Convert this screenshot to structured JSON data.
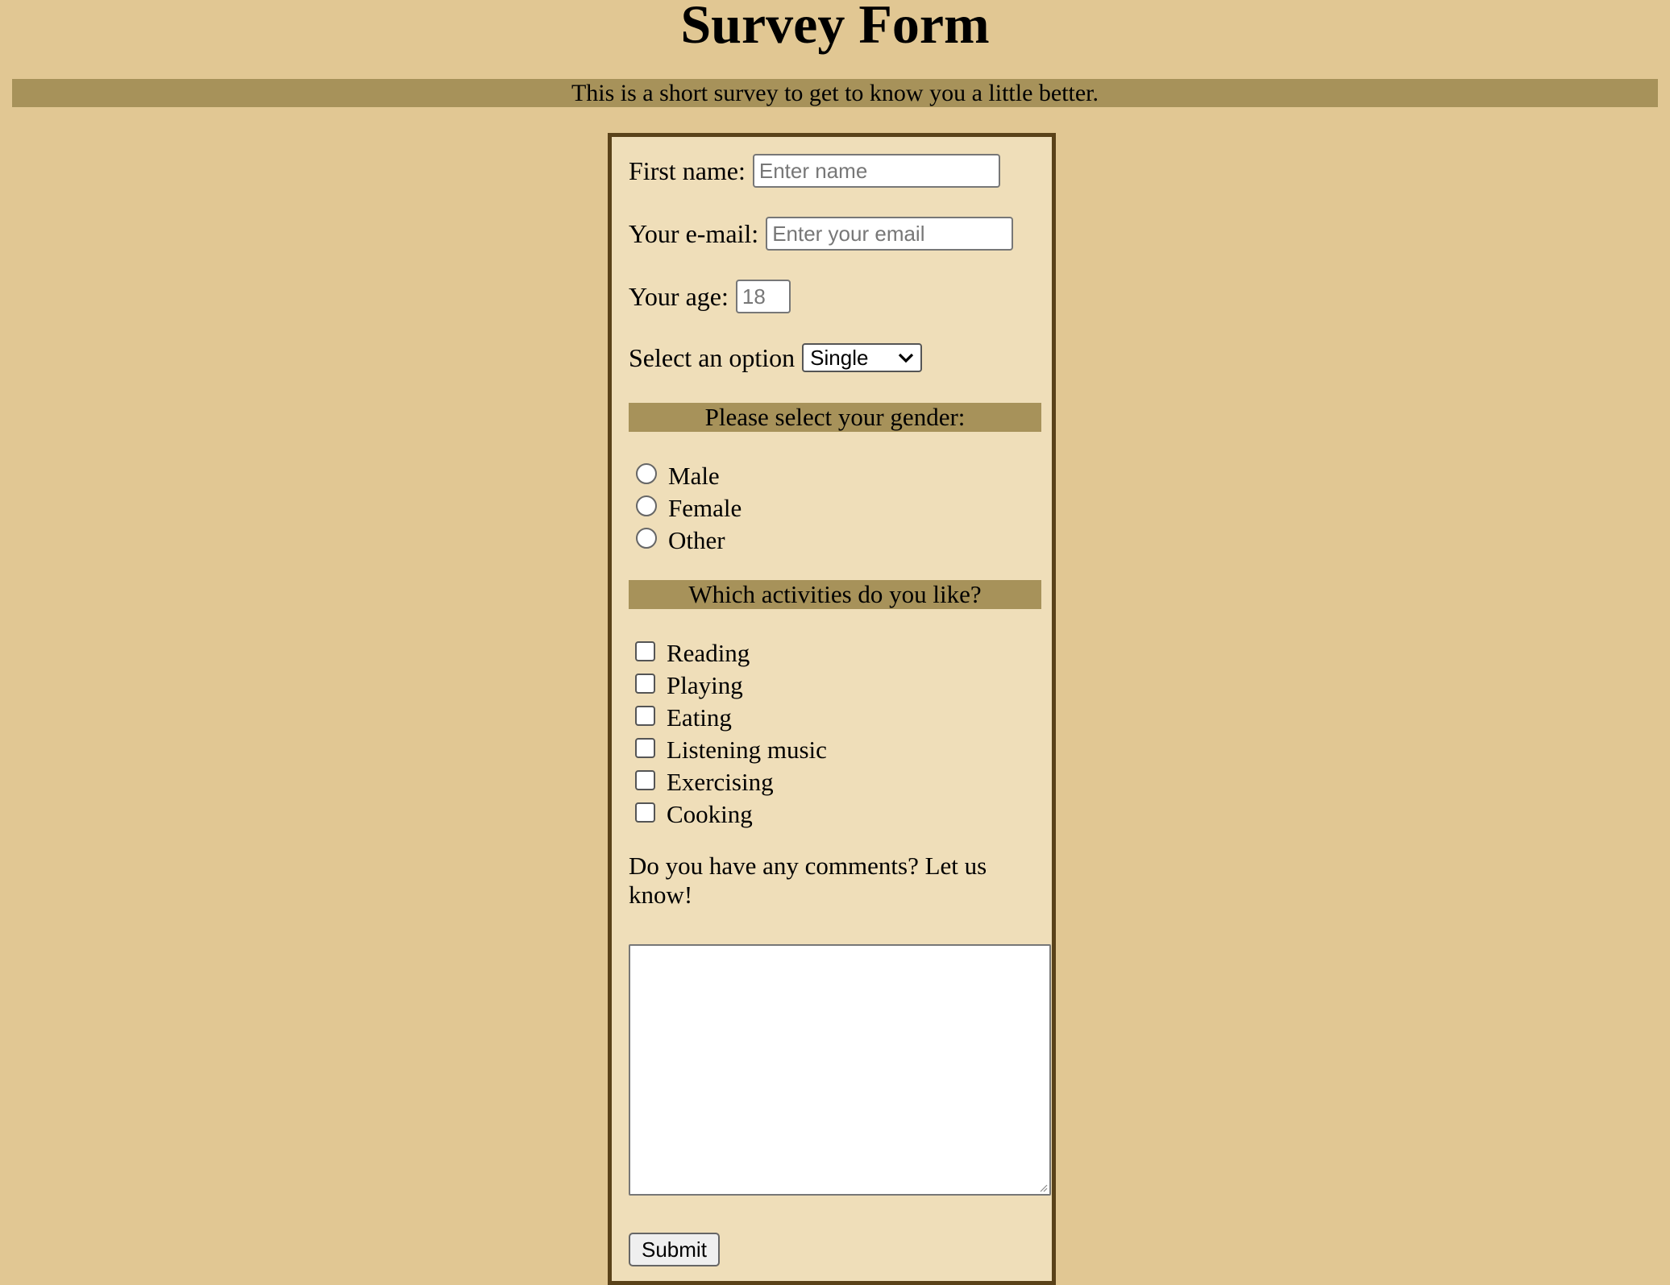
{
  "page": {
    "title": "Survey Form",
    "description": "This is a short survey to get to know you a little better."
  },
  "form": {
    "first_name": {
      "label": "First name:",
      "placeholder": "Enter name",
      "value": ""
    },
    "email": {
      "label": "Your e-mail:",
      "placeholder": "Enter your email",
      "value": ""
    },
    "age": {
      "label": "Your age:",
      "placeholder": "18",
      "value": ""
    },
    "status": {
      "label": "Select an option",
      "selected": "Single"
    },
    "gender": {
      "heading": "Please select your gender:",
      "options": [
        "Male",
        "Female",
        "Other"
      ]
    },
    "activities": {
      "heading": "Which activities do you like?",
      "options": [
        "Reading",
        "Playing",
        "Eating",
        "Listening music",
        "Exercising",
        "Cooking"
      ]
    },
    "comments": {
      "label": "Do you have any comments? Let us know!",
      "value": ""
    },
    "submit_label": "Submit"
  },
  "colors": {
    "page_background": "#e1c793",
    "banner": "#a7925a",
    "form_background": "#efdeb9",
    "form_border": "#5a4219"
  },
  "icons": {
    "select_arrow": "chevron-down-icon",
    "textarea_grip": "resize-grip-icon"
  }
}
